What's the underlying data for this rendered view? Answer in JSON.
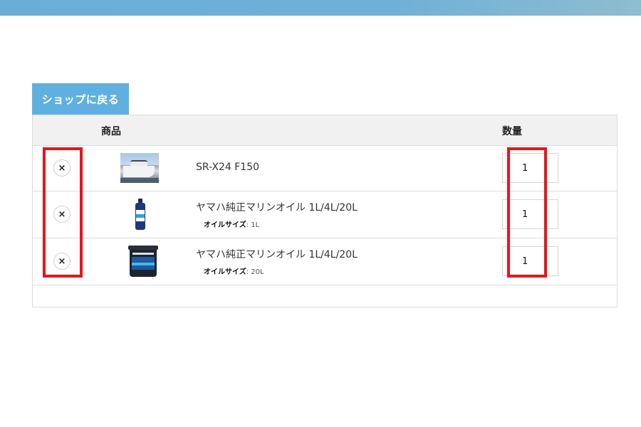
{
  "back_button": {
    "label": "ショップに戻る"
  },
  "table": {
    "headers": {
      "product": "商品",
      "quantity": "数量"
    },
    "items": [
      {
        "remove_icon": "×",
        "thumbnail": "boat-image",
        "name": "SR-X24 F150",
        "meta_label": "",
        "meta_value": "",
        "quantity": "1"
      },
      {
        "remove_icon": "×",
        "thumbnail": "oil-bottle-image",
        "name": "ヤマハ純正マリンオイル 1L/4L/20L",
        "meta_label": "オイルサイズ",
        "meta_value": ": 1L",
        "quantity": "1"
      },
      {
        "remove_icon": "×",
        "thumbnail": "oil-pail-image",
        "name": "ヤマハ純正マリンオイル 1L/4L/20L",
        "meta_label": "オイルサイズ",
        "meta_value": ": 20L",
        "quantity": "1"
      }
    ]
  },
  "colors": {
    "accent": "#5fb0e0",
    "highlight": "#e8141b",
    "header_bar": "#6aaed6"
  }
}
